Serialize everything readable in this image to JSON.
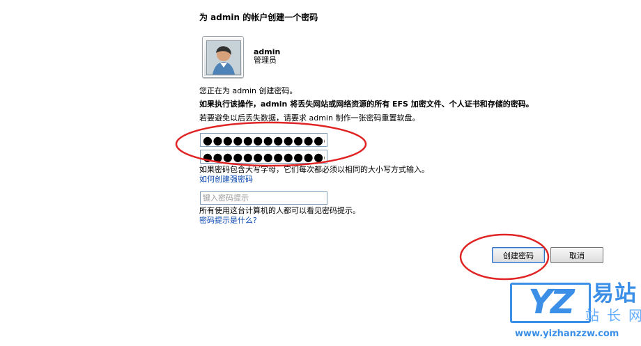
{
  "window": {
    "title": "为 admin 的帐户创建一个密码"
  },
  "account": {
    "name": "admin",
    "role": "管理员"
  },
  "content": {
    "intro": "您正在为 admin 创建密码。",
    "warning": "如果执行该操作，admin 将丢失网站或网络资源的所有 EFS 加密文件、个人证书和存储的密码。",
    "reset_disk_notice": "若要避免以后丢失数据，请要求 admin 制作一张密码重置软盘。",
    "case_notice": "如果密码包含大写字母，它们每次都必须以相同的大小写方式输入。",
    "strong_password_link": "如何创建强密码",
    "hint_notice": "所有使用这台计算机的人都可以看见密码提示。",
    "hint_link": "密码提示是什么?"
  },
  "fields": {
    "new_password_value": "●●●●●●●●●●●●●",
    "confirm_password_value": "●●●●●●●●●●●●●",
    "hint_placeholder": "键入密码提示",
    "hint_value": ""
  },
  "buttons": {
    "create_password": "创建密码",
    "cancel": "取消"
  },
  "watermark": {
    "letters": "YZ",
    "big_text": "易站",
    "sub_text": "站长网",
    "url": "www.yizhanzzw.com"
  },
  "colors": {
    "link": "#0645ad",
    "annotation_red": "#e02424",
    "watermark_blue": "#2c86e6"
  }
}
